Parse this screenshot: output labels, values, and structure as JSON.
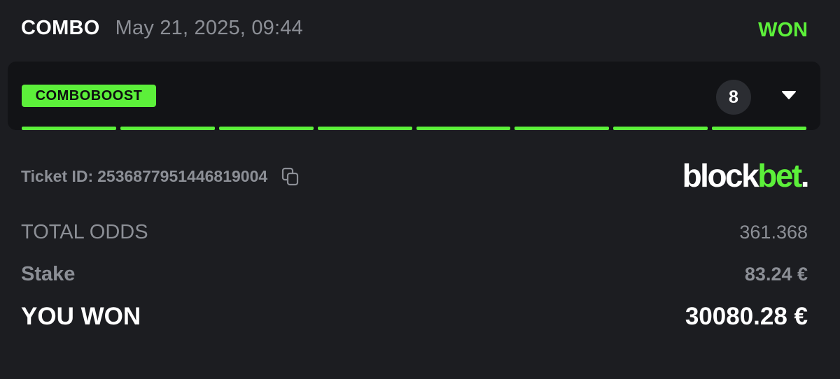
{
  "header": {
    "bet_type": "COMBO",
    "datetime": "May 21, 2025, 09:44",
    "status": "WON",
    "status_color": "#5cf03a"
  },
  "selections": {
    "badge": "COMBOBOOST",
    "count": "8",
    "toggle_icon": "caret-down-icon",
    "progress_segments_won": 8,
    "progress_segments_total": 8
  },
  "ticket": {
    "label": "Ticket ID:",
    "id": "2536877951446819004",
    "copy_icon": "copy-icon"
  },
  "brand": {
    "part1": "block",
    "part2": "bet",
    "part3": "."
  },
  "summary": {
    "total_odds_label": "TOTAL ODDS",
    "total_odds_value": "361.368",
    "stake_label": "Stake",
    "stake_value": "83.24 €",
    "won_label": "YOU WON",
    "won_value": "30080.28 €"
  },
  "colors": {
    "background": "#1c1d21",
    "panel": "#121316",
    "accent": "#5cf03a",
    "muted": "#8c8f96"
  }
}
